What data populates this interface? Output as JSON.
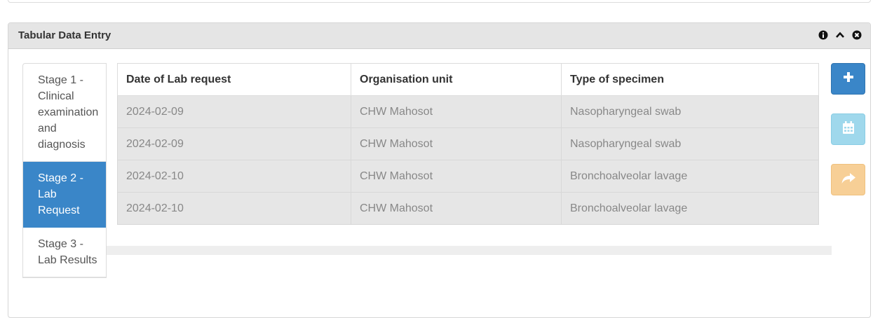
{
  "widget": {
    "title": "Tabular Data Entry",
    "icons": [
      "info-icon",
      "chevron-up-icon",
      "close-icon"
    ]
  },
  "stages": [
    {
      "label": "Stage 1 - Clinical examination and diagnosis",
      "active": false
    },
    {
      "label": "Stage 2 - Lab Request",
      "active": true
    },
    {
      "label": "Stage 3 - Lab Results",
      "active": false
    }
  ],
  "table": {
    "columns": [
      "Date of Lab request",
      "Organisation unit",
      "Type of specimen"
    ],
    "rows": [
      [
        "2024-02-09",
        "CHW Mahosot",
        "Nasopharyngeal swab"
      ],
      [
        "2024-02-09",
        "CHW Mahosot",
        "Nasopharyngeal swab"
      ],
      [
        "2024-02-10",
        "CHW Mahosot",
        "Bronchoalveolar lavage"
      ],
      [
        "2024-02-10",
        "CHW Mahosot",
        "Bronchoalveolar lavage"
      ]
    ]
  },
  "side_buttons": [
    {
      "icon": "plus-icon",
      "color": "#3a86c8"
    },
    {
      "icon": "calendar-icon",
      "color": "#9fd8ec"
    },
    {
      "icon": "share-arrow-icon",
      "color": "#f7cf96"
    }
  ]
}
